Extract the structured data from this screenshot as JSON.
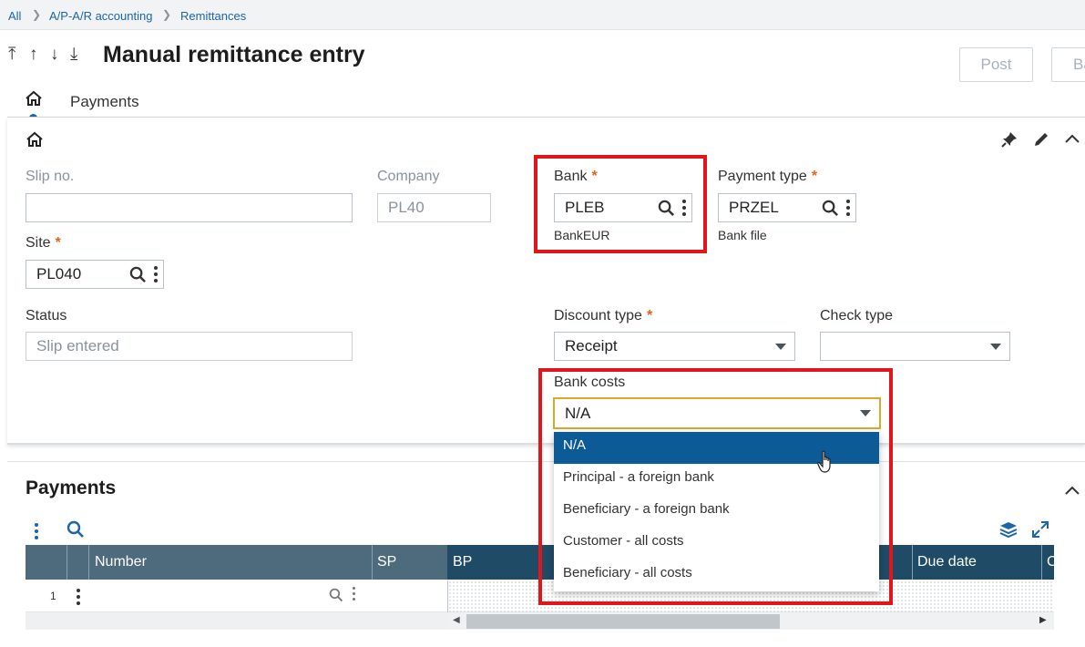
{
  "breadcrumb": {
    "items": [
      "All",
      "A/P-A/R accounting",
      "Remittances"
    ]
  },
  "header": {
    "title": "Manual remittance entry",
    "post_label": "Post",
    "next_button_label": "Ba"
  },
  "tabs": {
    "payments_label": "Payments"
  },
  "form": {
    "slip_no": {
      "label": "Slip no.",
      "value": ""
    },
    "company": {
      "label": "Company",
      "value": "PL40"
    },
    "bank": {
      "label": "Bank",
      "required_mark": "*",
      "value": "PLEB",
      "description": "BankEUR"
    },
    "payment_type": {
      "label": "Payment type",
      "required_mark": "*",
      "value": "PRZEL",
      "description": "Bank file"
    },
    "site": {
      "label": "Site",
      "required_mark": "*",
      "value": "PL040"
    },
    "status": {
      "label": "Status",
      "value": "Slip entered"
    },
    "discount_type": {
      "label": "Discount type",
      "required_mark": "*",
      "value": "Receipt"
    },
    "check_type": {
      "label": "Check type",
      "value": ""
    },
    "bank_costs": {
      "label": "Bank costs",
      "value": "N/A",
      "options": [
        "N/A",
        "Principal - a foreign bank",
        "Beneficiary - a foreign bank",
        "Customer - all costs",
        "Beneficiary - all costs"
      ],
      "selected_index": 0
    }
  },
  "payments": {
    "title": "Payments",
    "columns": [
      "Number",
      "SP",
      "BP",
      "Due date",
      "C"
    ],
    "rows": [
      {
        "line": "1",
        "number": ""
      }
    ]
  },
  "colors": {
    "accent": "#1a66a8",
    "selected_option": "#0c5a96",
    "highlight_border": "#e0161d",
    "required": "#e2631a",
    "table_header": "#4e6a7d"
  }
}
